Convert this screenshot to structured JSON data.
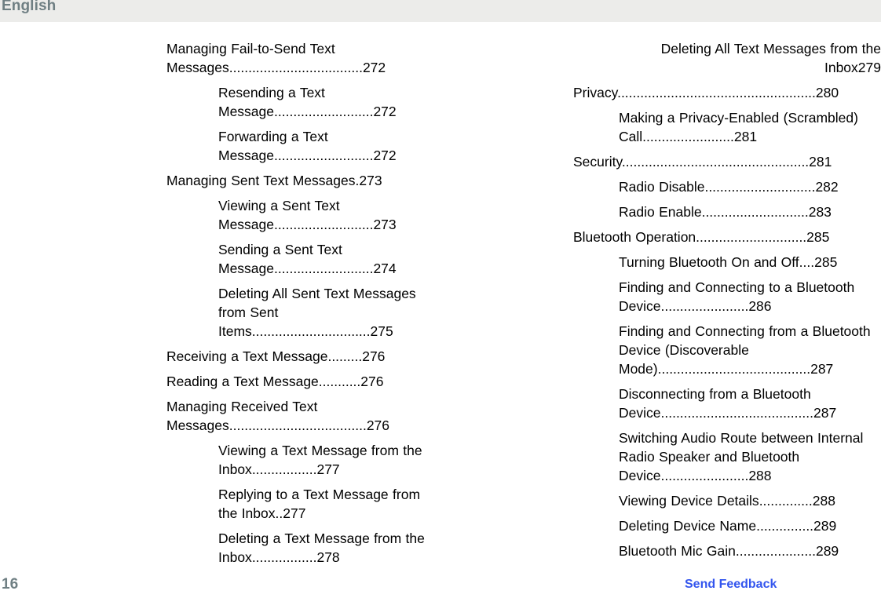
{
  "header": {
    "language_label": "English",
    "background_color": "#ececea",
    "text_color": "#6f7f83"
  },
  "footer": {
    "page_number": "16",
    "feedback_label": "Send Feedback",
    "feedback_color": "#3355ee",
    "page_number_color": "#6f7f83"
  },
  "toc": {
    "leader_char": ".",
    "left_column": [
      {
        "level": 1,
        "title": "Managing Fail-to-Send Text Messages",
        "leader": "...................................",
        "page": "272",
        "no_leader": false
      },
      {
        "level": 2,
        "title": "Resending a Text Message",
        "leader": "..........................",
        "page": "272",
        "no_leader": false
      },
      {
        "level": 2,
        "title": "Forwarding a Text Message",
        "leader": "..........................",
        "page": "272",
        "no_leader": false
      },
      {
        "level": 1,
        "title": "Managing Sent Text Messages",
        "leader": ".",
        "page": "273",
        "no_leader": false
      },
      {
        "level": 2,
        "title": "Viewing a Sent Text Message",
        "leader": "..........................",
        "page": "273",
        "no_leader": false
      },
      {
        "level": 2,
        "title": "Sending a Sent Text Message",
        "leader": "..........................",
        "page": "274",
        "no_leader": false
      },
      {
        "level": 2,
        "title": "Deleting All Sent Text Messages from Sent Items",
        "leader": "...............................",
        "page": "275",
        "no_leader": false
      },
      {
        "level": 1,
        "title": "Receiving a Text Message",
        "leader": ".........",
        "page": "276",
        "no_leader": false
      },
      {
        "level": 1,
        "title": "Reading a Text Message",
        "leader": "...........",
        "page": "276",
        "no_leader": false
      },
      {
        "level": 1,
        "title": "Managing Received Text Messages",
        "leader": "....................................",
        "page": "276",
        "no_leader": false
      },
      {
        "level": 2,
        "title": "Viewing a Text Message from the Inbox",
        "leader": ".................",
        "page": "277",
        "no_leader": false
      },
      {
        "level": 2,
        "title": "Replying to a Text Message from the Inbox",
        "leader": "..",
        "page": "277",
        "no_leader": false
      },
      {
        "level": 2,
        "title": "Deleting a Text Message from the Inbox",
        "leader": ".................",
        "page": "278",
        "no_leader": false
      }
    ],
    "right_column": [
      {
        "level": 2,
        "title": "Deleting All Text Messages from the Inbox",
        "leader": "",
        "page": "279",
        "no_leader": true
      },
      {
        "level": 1,
        "title": "Privacy",
        "leader": "....................................................",
        "page": "280",
        "no_leader": false
      },
      {
        "level": 2,
        "title": "Making a Privacy-Enabled (Scrambled) Call",
        "leader": "........................",
        "page": "281",
        "no_leader": false
      },
      {
        "level": 1,
        "title": "Security",
        "leader": ".................................................",
        "page": "281",
        "no_leader": false
      },
      {
        "level": 2,
        "title": "Radio Disable",
        "leader": ".............................",
        "page": "282",
        "no_leader": false
      },
      {
        "level": 2,
        "title": "Radio Enable",
        "leader": "............................",
        "page": "283",
        "no_leader": false
      },
      {
        "level": 1,
        "title": "Bluetooth Operation",
        "leader": ".............................",
        "page": "285",
        "no_leader": false
      },
      {
        "level": 2,
        "title": "Turning Bluetooth On and Off",
        "leader": "....",
        "page": "285",
        "no_leader": false
      },
      {
        "level": 2,
        "title": "Finding and Connecting to a Bluetooth Device",
        "leader": ".......................",
        "page": "286",
        "no_leader": false
      },
      {
        "level": 2,
        "title": "Finding and Connecting from a Bluetooth Device (Discoverable Mode)",
        "leader": "........................................",
        "page": "287",
        "no_leader": false
      },
      {
        "level": 2,
        "title": "Disconnecting from a Bluetooth Device",
        "leader": "........................................",
        "page": "287",
        "no_leader": false
      },
      {
        "level": 2,
        "title": "Switching Audio Route between Internal Radio Speaker and Bluetooth Device",
        "leader": ".......................",
        "page": "288",
        "no_leader": false
      },
      {
        "level": 2,
        "title": "Viewing Device Details",
        "leader": "..............",
        "page": "288",
        "no_leader": false
      },
      {
        "level": 2,
        "title": "Deleting Device Name",
        "leader": "...............",
        "page": "289",
        "no_leader": false
      },
      {
        "level": 2,
        "title": "Bluetooth Mic Gain",
        "leader": ".....................",
        "page": "289",
        "no_leader": false
      }
    ]
  }
}
